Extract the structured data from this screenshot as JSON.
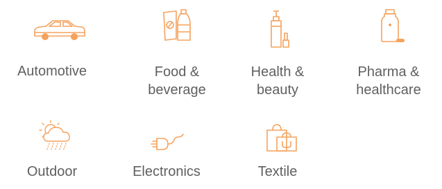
{
  "accent_color": "#F5A25D",
  "text_color": "#5F5F5F",
  "industries": [
    {
      "icon": "car-icon",
      "lines": [
        "Automotive"
      ]
    },
    {
      "icon": "food-beverage-icon",
      "lines": [
        "Food &",
        "beverage"
      ]
    },
    {
      "icon": "cosmetics-icon",
      "lines": [
        "Health &",
        "beauty"
      ]
    },
    {
      "icon": "medicine-bottle-icon",
      "lines": [
        "Pharma &",
        "healthcare"
      ]
    },
    {
      "icon": "weather-icon",
      "lines": [
        "Outdoor"
      ]
    },
    {
      "icon": "plug-icon",
      "lines": [
        "Electronics"
      ]
    },
    {
      "icon": "shopping-bags-icon",
      "lines": [
        "Textile"
      ]
    }
  ]
}
